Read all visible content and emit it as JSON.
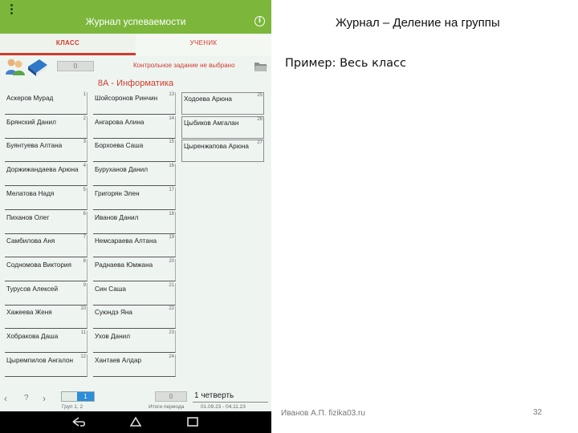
{
  "app": {
    "title": "Журнал успеваемости",
    "tabs": [
      {
        "label": "КЛАСС",
        "active": true
      },
      {
        "label": "УЧЕНИК",
        "active": false
      }
    ],
    "toolbar": {
      "grey_value": "0",
      "control_text": "Контрольное задание не выбрано"
    },
    "class_title": "8А - Информатика",
    "students": [
      {
        "name": "Аскеров Мурад",
        "num": "1"
      },
      {
        "name": "Брянский Данил",
        "num": "2"
      },
      {
        "name": "Буянтуева Алтана",
        "num": "3"
      },
      {
        "name": "Доржижандаева Арюна",
        "num": "4"
      },
      {
        "name": "Мелатова Надя",
        "num": "5"
      },
      {
        "name": "Пиханов Олег",
        "num": "6"
      },
      {
        "name": "Самбилова Аня",
        "num": "7"
      },
      {
        "name": "Содномова Виктория",
        "num": "8"
      },
      {
        "name": "Турусов Алексей",
        "num": "9"
      },
      {
        "name": "Хажеева Женя",
        "num": "10"
      },
      {
        "name": "Хобракова Даша",
        "num": "11"
      },
      {
        "name": "Цыремпилов Ангалон",
        "num": "12"
      },
      {
        "name": "Шойсоронов Ринчин",
        "num": "13"
      },
      {
        "name": "Ангарова Алина",
        "num": "14"
      },
      {
        "name": "Борхоева Саша",
        "num": "15"
      },
      {
        "name": "Буруханов Данил",
        "num": "16"
      },
      {
        "name": "Григорян Элен",
        "num": "17"
      },
      {
        "name": "Иванов Данил",
        "num": "18"
      },
      {
        "name": "Немсараева Алтана",
        "num": "19"
      },
      {
        "name": "Раднаева Юмжана",
        "num": "20"
      },
      {
        "name": "Син Саша",
        "num": "21"
      },
      {
        "name": "Суюндэ Яна",
        "num": "22"
      },
      {
        "name": "Ухов Данил",
        "num": "23"
      },
      {
        "name": "Хантаев Алдар",
        "num": "24"
      },
      {
        "name": "Ходоева Арюна",
        "num": "25"
      },
      {
        "name": "Цыбиков Амгалан",
        "num": "26"
      },
      {
        "name": "Цыренжапова Арюна",
        "num": "27"
      }
    ],
    "bottom": {
      "group_value": "1",
      "group_label": "Груп 1, 2",
      "period_value": "0",
      "quarter_label": "1 четверть",
      "period_label": "Итоги периода",
      "period_range": "01.09.23 - 04.11.23"
    },
    "colors": {
      "appbar": "#7cb73c",
      "accent_red": "#d23a2c",
      "selection_blue": "#2b8ed8"
    }
  },
  "slide": {
    "title": "Журнал – Деление на группы",
    "subtitle": "Пример: Весь класс",
    "footer": "Иванов А.П. fizika03.ru",
    "page_number": "32"
  }
}
